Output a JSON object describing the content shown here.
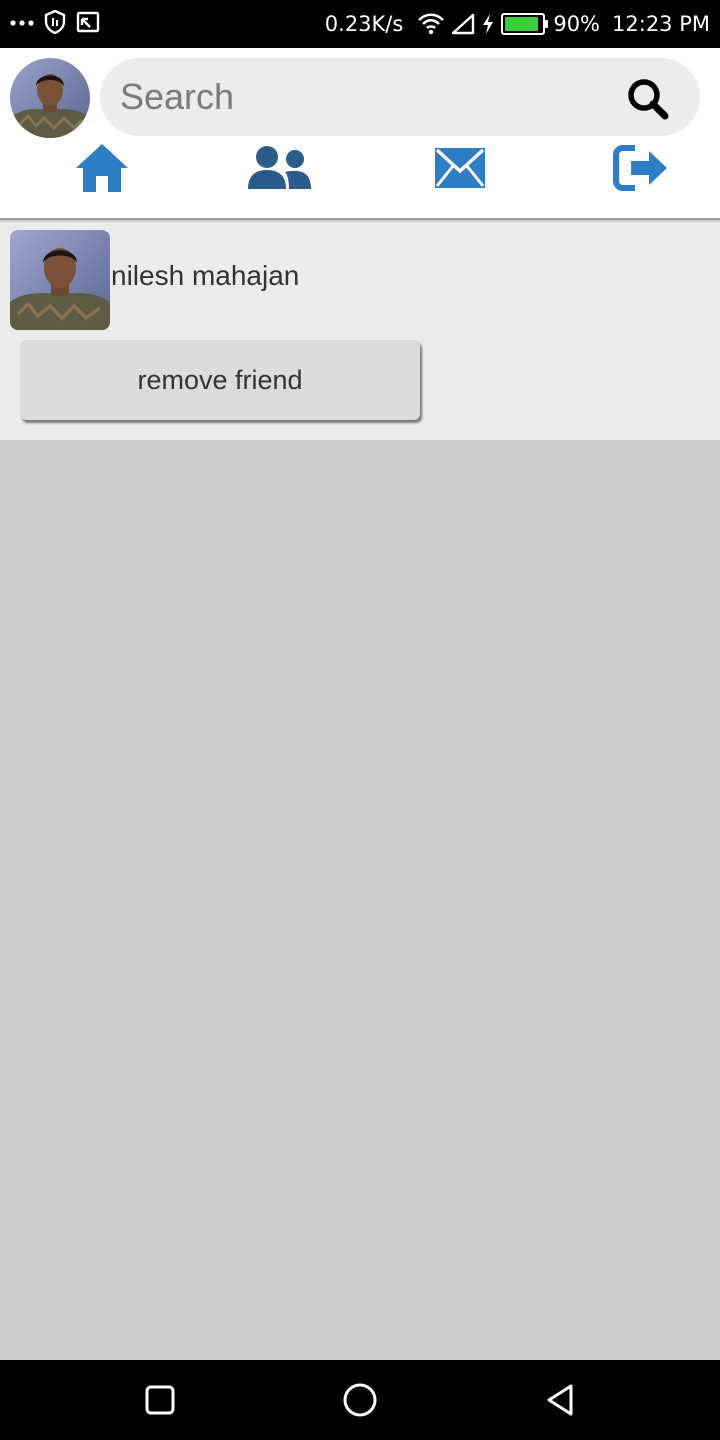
{
  "status_bar": {
    "icons_left": [
      "more-dots-icon",
      "shield-icon",
      "cast-icon"
    ],
    "network_speed": "0.23K/s",
    "icons_right": [
      "wifi-icon",
      "signal-icon",
      "charging-icon",
      "battery-icon"
    ],
    "battery_percent": "90%",
    "battery_level": 0.9,
    "time": "12:23 PM"
  },
  "header": {
    "avatar": "profile-avatar",
    "search": {
      "placeholder": "Search",
      "value": "",
      "icon": "search-icon"
    },
    "nav": [
      {
        "icon": "home-icon",
        "color": "#2d7ec5"
      },
      {
        "icon": "friends-icon",
        "color": "#2a5b8a"
      },
      {
        "icon": "mail-icon",
        "color": "#2d7ec5"
      },
      {
        "icon": "logout-icon",
        "color": "#2d7ec5"
      }
    ]
  },
  "friends": [
    {
      "name": "nilesh mahajan",
      "action_label": "remove friend"
    }
  ],
  "system_nav": [
    "recents-button",
    "home-button",
    "back-button"
  ],
  "colors": {
    "accent_blue": "#2d7ec5",
    "page_background": "#cccccc",
    "card_background": "#ececec"
  }
}
